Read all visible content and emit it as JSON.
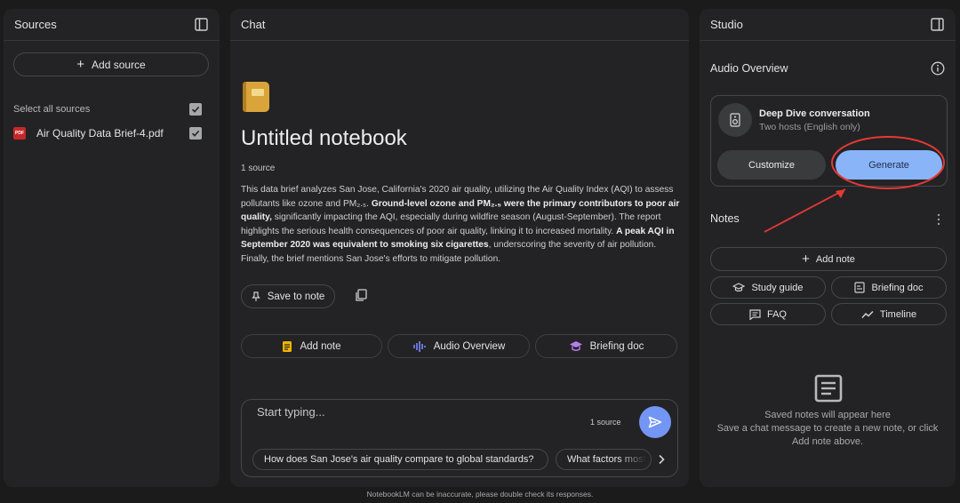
{
  "sources": {
    "title": "Sources",
    "add_label": "Add source",
    "select_all": "Select all sources",
    "items": [
      {
        "name": "Air Quality Data Brief-4.pdf"
      }
    ]
  },
  "chat": {
    "title": "Chat",
    "notebook_title": "Untitled notebook",
    "source_count": "1 source",
    "summary": {
      "p1": "This data brief analyzes San Jose, California's 2020 air quality, utilizing the Air Quality Index (AQI) to assess pollutants like ozone and PM₂.₅. ",
      "b1": "Ground-level ozone and PM₂.₅ were the primary contributors to poor air quality,",
      "p2": " significantly impacting the AQI, especially during wildfire season (August-September). The report highlights the serious health consequences of poor air quality, linking it to increased mortality. ",
      "b2": "A peak AQI in September 2020 was equivalent to smoking six cigarettes",
      "p3": ", underscoring the severity of air pollution. Finally, the brief mentions San Jose's efforts to mitigate pollution."
    },
    "save_to_note": "Save to note",
    "actions": {
      "add_note": "Add note",
      "audio_overview": "Audio Overview",
      "briefing_doc": "Briefing doc"
    },
    "input": {
      "placeholder": "Start typing...",
      "source_count": "1 source",
      "suggestions": [
        "How does San Jose's air quality compare to global standards?",
        "What factors most"
      ]
    }
  },
  "studio": {
    "title": "Studio",
    "audio_overview": "Audio Overview",
    "card": {
      "title": "Deep Dive conversation",
      "subtitle": "Two hosts (English only)",
      "customize": "Customize",
      "generate": "Generate"
    },
    "notes": {
      "title": "Notes",
      "add_note": "Add note",
      "study_guide": "Study guide",
      "briefing_doc": "Briefing doc",
      "faq": "FAQ",
      "timeline": "Timeline",
      "empty_line1": "Saved notes will appear here",
      "empty_line2": "Save a chat message to create a new note, or click",
      "empty_line3": "Add note above."
    }
  },
  "footer": "NotebookLM can be inaccurate, please double check its responses.",
  "colors": {
    "accent": "#8ab4f8",
    "send": "#7395f4",
    "annotation": "#e53935",
    "pdf": "#c62828"
  }
}
